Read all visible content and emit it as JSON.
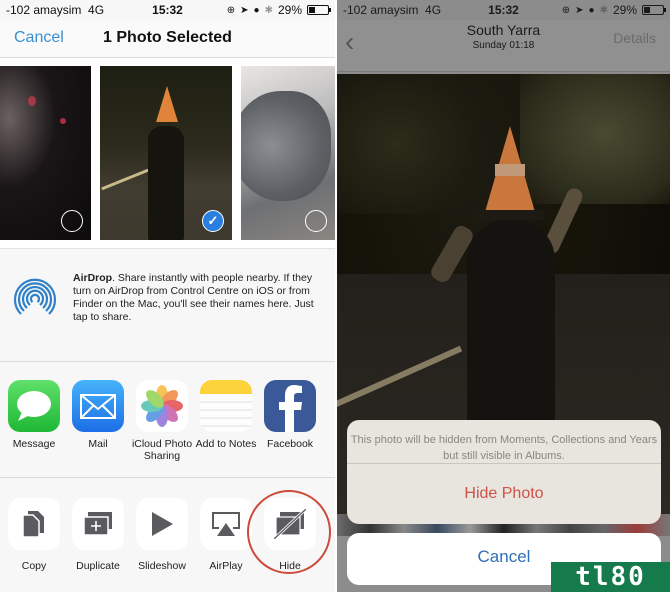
{
  "left": {
    "status": {
      "carrier": "-102 amaysim",
      "network": "4G",
      "time": "15:32",
      "battery": "29%",
      "battery_level": 0.29
    },
    "navbar": {
      "cancel_label": "Cancel",
      "title": "1 Photo Selected"
    },
    "thumbnails": [
      {
        "name": "concert-photo",
        "selected": false
      },
      {
        "name": "cone-hat-photo",
        "selected": true,
        "check": "✓"
      },
      {
        "name": "cat-photo",
        "selected": false
      }
    ],
    "airdrop": {
      "title": "AirDrop",
      "text": ". Share instantly with people nearby. If they turn on AirDrop from Control Centre on iOS or from Finder on the Mac, you'll see their names here. Just tap to share."
    },
    "share_apps": [
      {
        "label": "Message",
        "icon": "message-icon",
        "color": "#35c84a"
      },
      {
        "label": "Mail",
        "icon": "mail-icon",
        "color": "#2f8cf0"
      },
      {
        "label": "iCloud Photo Sharing",
        "icon": "photos-icon",
        "color": "#ffffff"
      },
      {
        "label": "Add to Notes",
        "icon": "notes-icon",
        "color": "#ffd43b"
      },
      {
        "label": "Facebook",
        "icon": "facebook-icon",
        "color": "#3b5998"
      }
    ],
    "actions": [
      {
        "label": "Copy",
        "icon": "copy-icon"
      },
      {
        "label": "Duplicate",
        "icon": "duplicate-icon"
      },
      {
        "label": "Slideshow",
        "icon": "slideshow-icon"
      },
      {
        "label": "AirPlay",
        "icon": "airplay-icon"
      },
      {
        "label": "Hide",
        "icon": "hide-icon",
        "highlighted": true
      }
    ]
  },
  "right": {
    "status": {
      "carrier": "-102 amaysim",
      "network": "4G",
      "time": "15:32",
      "battery": "29%",
      "battery_level": 0.29
    },
    "navbar": {
      "back_glyph": "‹",
      "title": "South Yarra",
      "subtitle": "Sunday  01:18",
      "details_label": "Details"
    },
    "action_sheet": {
      "message": "This photo will be hidden from Moments, Collections and Years but still visible in Albums.",
      "hide_label": "Hide Photo",
      "cancel_label": "Cancel"
    }
  },
  "watermark": "tl80",
  "colors": {
    "ios_blue": "#3b8fd1",
    "destructive_red": "#d0504a",
    "highlight_ring": "#cc4b3c",
    "watermark_green": "#157a4c"
  }
}
